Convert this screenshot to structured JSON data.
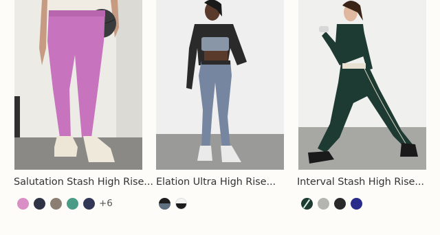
{
  "products": [
    {
      "title": "Salutation Stash High Rise...",
      "more_colors": "+6",
      "swatches": [
        {
          "name": "pink",
          "color": "#d98fc6"
        },
        {
          "name": "navy",
          "color": "#2e3346"
        },
        {
          "name": "taupe",
          "color": "#8b7f73"
        },
        {
          "name": "green",
          "color": "#4a9c86"
        },
        {
          "name": "dark-navy",
          "color": "#323756"
        }
      ]
    },
    {
      "title": "Elation Ultra High Rise...",
      "more_colors": "",
      "swatches": [
        {
          "name": "black-slate",
          "color": "#1d1d1d",
          "color2": "#607080"
        },
        {
          "name": "white-black",
          "color": "#f4f4f4",
          "color2": "#1c1c1c"
        }
      ]
    },
    {
      "title": "Interval Stash High Rise...",
      "more_colors": "",
      "swatches": [
        {
          "name": "dark-green",
          "color": "#1d3b33"
        },
        {
          "name": "grey",
          "color": "#b4b4b0"
        },
        {
          "name": "black",
          "color": "#2a2a2a"
        },
        {
          "name": "indigo",
          "color": "#292b8a"
        }
      ]
    }
  ]
}
